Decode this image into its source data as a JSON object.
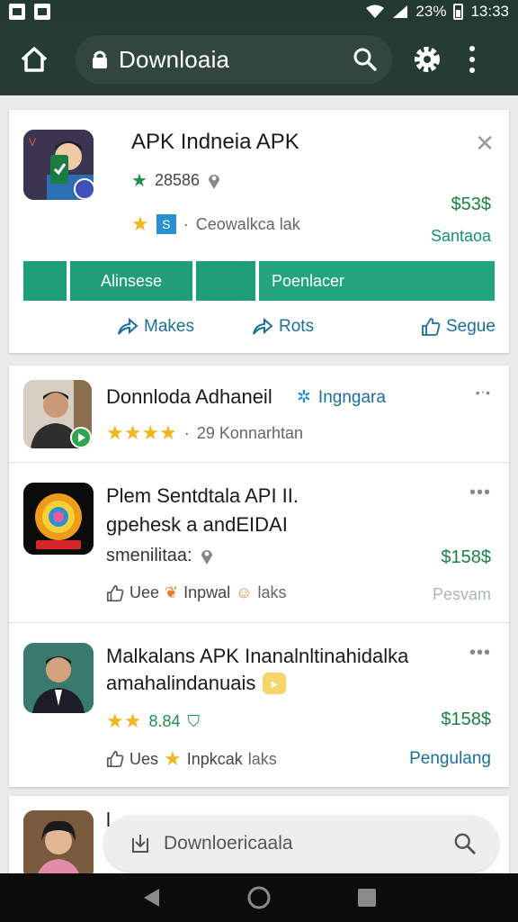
{
  "status_bar": {
    "battery": "23%",
    "time": "13:33"
  },
  "toolbar": {
    "url_text": "Downloaia"
  },
  "featured": {
    "title": "APK Indneia APK",
    "rating": "28586",
    "developer": "Ceowalkca lak",
    "price": "$53$",
    "sub_label": "Santaoa",
    "buttons": [
      "Alinsese",
      "Poenlacer"
    ],
    "actions": [
      "Makes",
      "Rots",
      "Segue"
    ]
  },
  "list": [
    {
      "title": "Donnloda Adhaneil",
      "tag": "Ingngara",
      "reviews": "29 Konnarhtan"
    },
    {
      "title_line1": "Plem Sentdtala API II.",
      "title_line2": "gpehesk a andEIDAI",
      "subtitle": "smenilitaa:",
      "price": "$158$",
      "meta1": "Uee",
      "meta2": "Inpwal",
      "meta3": "laks",
      "status": "Pesvam"
    },
    {
      "title_line1": "Malkalans APK Inanalnltinahidalka",
      "title_line2": "amahalindanuais",
      "rating": "8.84",
      "price": "$158$",
      "meta1": "Ues",
      "meta2": "Inpkcak",
      "meta3": "laks",
      "action": "Pengulang"
    }
  ],
  "partial": {
    "title": "l"
  },
  "float_search": {
    "placeholder": "Downloericaala"
  },
  "colors": {
    "toolbar": "#253c33",
    "accent": "#1f9e77",
    "price_green": "#1a8244",
    "link_blue": "#1b6f9b"
  }
}
